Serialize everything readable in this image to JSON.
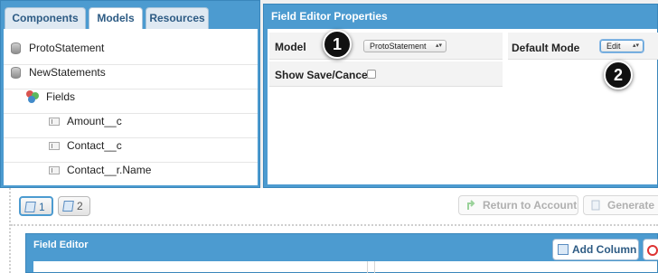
{
  "left_tabs": [
    {
      "label": "Components",
      "active": false
    },
    {
      "label": "Models",
      "active": true
    },
    {
      "label": "Resources",
      "active": false
    }
  ],
  "tree": {
    "models": [
      "ProtoStatement",
      "NewStatements"
    ],
    "fields_group": "Fields",
    "fields": [
      "Amount__c",
      "Contact__c",
      "Contact__r.Name"
    ]
  },
  "properties_panel": {
    "title": "Field Editor Properties",
    "model_label": "Model",
    "model_value": "ProtoStatement",
    "default_mode_label": "Default Mode",
    "default_mode_value": "Edit",
    "show_save_cancel_label": "Show Save/Cancel"
  },
  "callouts": [
    "1",
    "2"
  ],
  "pages": [
    "1",
    "2"
  ],
  "toolbar": {
    "return_label": "Return to Account",
    "generate_label": "Generate"
  },
  "field_editor": {
    "title": "Field Editor",
    "add_column_label": "Add Column"
  },
  "colors": {
    "panel_blue": "#4c9bd0",
    "callout": "#111111"
  }
}
